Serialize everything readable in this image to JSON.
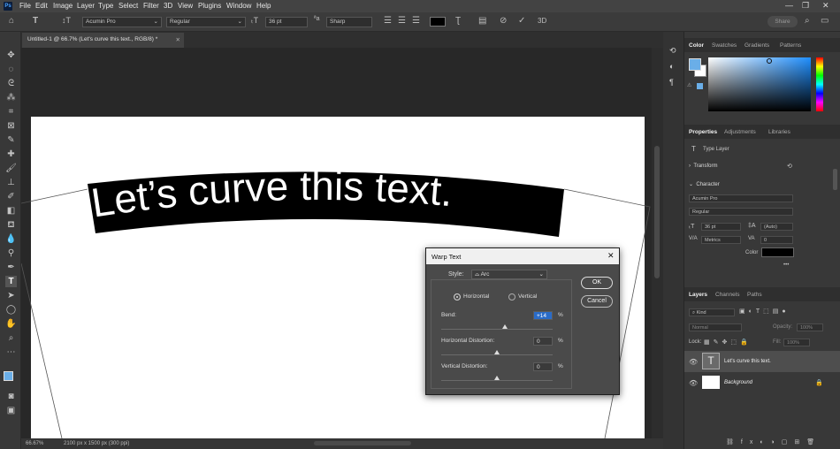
{
  "menu": [
    "File",
    "Edit",
    "Image",
    "Layer",
    "Type",
    "Select",
    "Filter",
    "3D",
    "View",
    "Plugins",
    "Window",
    "Help"
  ],
  "window_controls": {
    "minimize": "—",
    "maximize": "❐",
    "close": "✕"
  },
  "options": {
    "font_family": "Acumin Pro",
    "font_style": "Regular",
    "font_size": "36 pt",
    "antialias": "Sharp",
    "share": "Share",
    "text_color": "#000000",
    "threed": "3D"
  },
  "doc_tab": {
    "title": "Untitled-1 @ 66.7% (Let's curve this text., RGB/8) *",
    "close": "✕"
  },
  "canvas_text": "Let’s curve this text.",
  "status": {
    "zoom": "66.67%",
    "info": "2100 px x 1500 px (300 ppi)"
  },
  "color_panel": {
    "tabs": [
      "Color",
      "Swatches",
      "Gradients",
      "Patterns"
    ],
    "fg": "#6aaee8"
  },
  "properties": {
    "tabs": [
      "Properties",
      "Adjustments",
      "Libraries"
    ],
    "type_layer": "Type Layer",
    "transform": "Transform",
    "character": "Character",
    "font_family": "Acumin Pro",
    "font_style": "Regular",
    "size": "36 pt",
    "leading": "(Auto)",
    "kerning": "Metrics",
    "tracking": "0",
    "color_label": "Color",
    "more": "•••"
  },
  "layers": {
    "tabs": [
      "Layers",
      "Channels",
      "Paths"
    ],
    "kind": "Kind",
    "blend": "Normal",
    "opacity_label": "Opacity:",
    "opacity": "100%",
    "lock_label": "Lock:",
    "fill_label": "Fill:",
    "fill": "100%",
    "items": [
      {
        "name": "Let's curve this text.",
        "thumb": "T"
      },
      {
        "name": "Background",
        "thumb": ""
      }
    ]
  },
  "dialog": {
    "title": "Warp Text",
    "style_label": "Style:",
    "style_value": "Arc",
    "horizontal": "Horizontal",
    "vertical": "Vertical",
    "bend_label": "Bend:",
    "bend": "+14",
    "hdist_label": "Horizontal Distortion:",
    "hdist": "0",
    "vdist_label": "Vertical Distortion:",
    "vdist": "0",
    "pct": "%",
    "ok": "OK",
    "cancel": "Cancel",
    "close": "✕"
  }
}
